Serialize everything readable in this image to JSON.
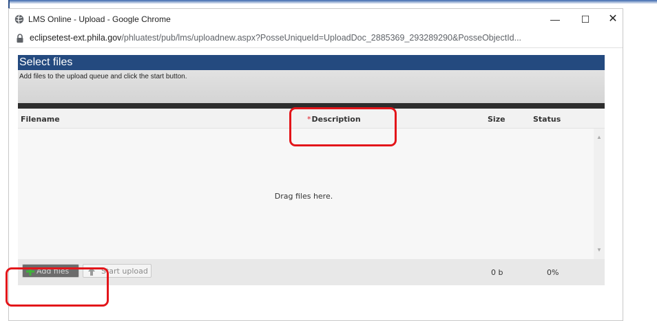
{
  "window": {
    "title": "LMS Online - Upload - Google Chrome",
    "min_label": "—",
    "max_label": "☐",
    "close_label": "✕"
  },
  "address": {
    "host": "eclipsetest-ext.phila.gov",
    "path": "/phluatest/pub/lms/uploadnew.aspx?PosseUniqueId=UploadDoc_2885369_293289290&PosseObjectId..."
  },
  "uploader": {
    "title": "Select files",
    "subtitle": "Add files to the upload queue and click the start button.",
    "columns": {
      "filename": "Filename",
      "description": "Description",
      "required_marker": "*",
      "size": "Size",
      "status": "Status"
    },
    "drop_message": "Drag files here.",
    "add_button": "Add files",
    "start_button": "Start upload",
    "total_size": "0 b",
    "total_percent": "0%"
  },
  "colors": {
    "header_blue": "#244a7f",
    "highlight_red": "#e3151a",
    "add_green": "#3fb23a"
  }
}
